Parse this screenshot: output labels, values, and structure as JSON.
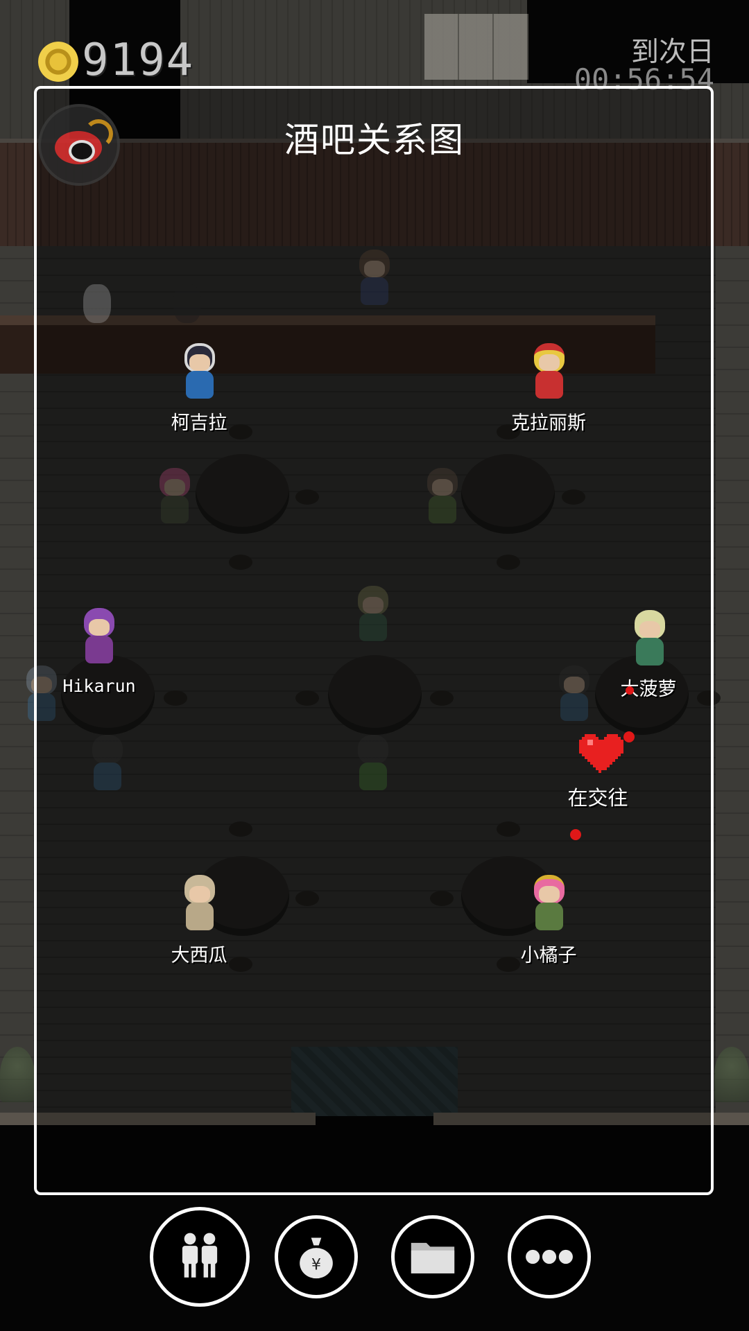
{
  "hud": {
    "coins": "9194",
    "timer_label": "到次日",
    "timer_value": "00:56:54"
  },
  "panel": {
    "title": "酒吧关系图"
  },
  "characters": [
    {
      "name": "柯吉拉"
    },
    {
      "name": "克拉丽斯"
    },
    {
      "name": "Hikarun"
    },
    {
      "name": "大菠萝"
    },
    {
      "name": "大西瓜"
    },
    {
      "name": "小橘子"
    }
  ],
  "relationship": {
    "label": "在交往",
    "heart_color": "#e82020"
  },
  "toolbar": {
    "buttons": [
      {
        "icon": "people-icon"
      },
      {
        "icon": "money-bag-icon"
      },
      {
        "icon": "folder-icon"
      },
      {
        "icon": "more-icon"
      }
    ]
  },
  "colors": {
    "panel_border": "#ffffff",
    "coin_gold": "#e8c23a",
    "heart_red": "#e82020"
  }
}
